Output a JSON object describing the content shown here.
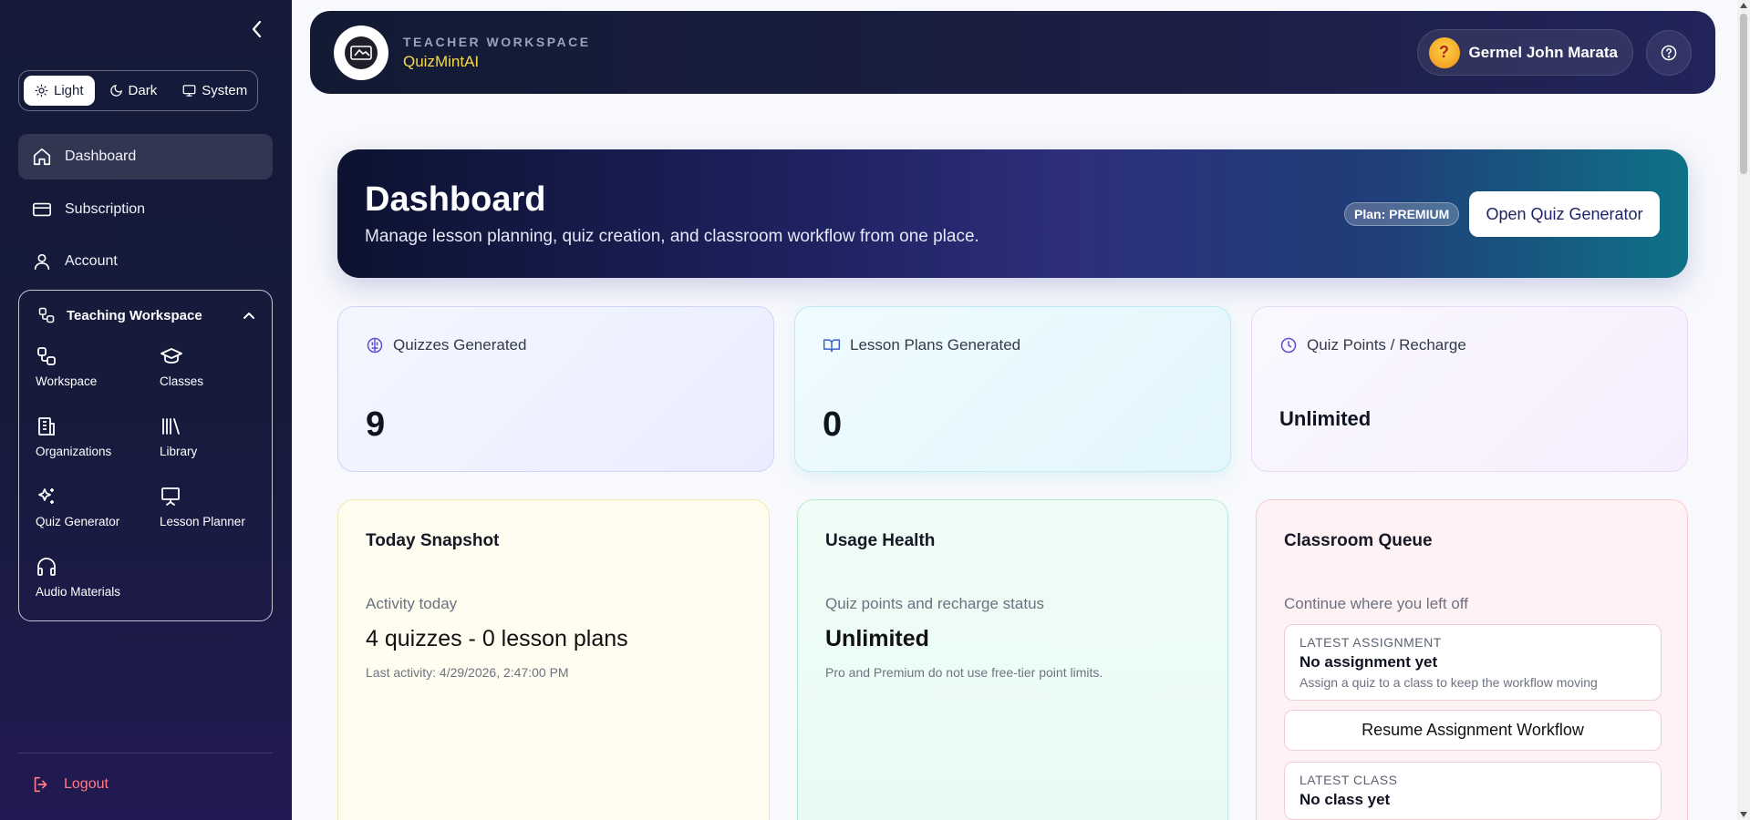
{
  "sidebar": {
    "theme": {
      "options": [
        {
          "label": "Light",
          "icon": "sun-icon",
          "active": true
        },
        {
          "label": "Dark",
          "icon": "moon-icon",
          "active": false
        },
        {
          "label": "System",
          "icon": "monitor-icon",
          "active": false
        }
      ]
    },
    "nav": [
      {
        "label": "Dashboard",
        "icon": "home-icon",
        "active": true
      },
      {
        "label": "Subscription",
        "icon": "credit-card-icon",
        "active": false
      },
      {
        "label": "Account",
        "icon": "user-icon",
        "active": false
      }
    ],
    "workspace_group": {
      "title": "Teaching Workspace",
      "expanded": true,
      "items": [
        {
          "label": "Workspace",
          "icon": "workspace-icon"
        },
        {
          "label": "Classes",
          "icon": "graduation-cap-icon"
        },
        {
          "label": "Organizations",
          "icon": "building-icon"
        },
        {
          "label": "Library",
          "icon": "library-icon"
        },
        {
          "label": "Quiz Generator",
          "icon": "sparkles-icon"
        },
        {
          "label": "Lesson Planner",
          "icon": "presentation-icon"
        },
        {
          "label": "Audio Materials",
          "icon": "headphones-icon"
        }
      ]
    },
    "logout_label": "Logout"
  },
  "topbar": {
    "eyebrow": "TEACHER WORKSPACE",
    "brand": "QuizMintAI",
    "user_name": "Germel John Marata"
  },
  "hero": {
    "title": "Dashboard",
    "subtitle": "Manage lesson planning, quiz creation, and classroom workflow from one place.",
    "plan_badge": "Plan: PREMIUM",
    "cta_label": "Open Quiz Generator"
  },
  "stats": [
    {
      "label": "Quizzes Generated",
      "value": "9",
      "icon": "brain-icon"
    },
    {
      "label": "Lesson Plans Generated",
      "value": "0",
      "icon": "book-open-icon"
    },
    {
      "label": "Quiz Points / Recharge",
      "value": "Unlimited",
      "icon": "clock-icon"
    }
  ],
  "today": {
    "title": "Today Snapshot",
    "label": "Activity today",
    "value": "4 quizzes - 0 lesson plans",
    "note": "Last activity: 4/29/2026, 2:47:00 PM"
  },
  "usage": {
    "title": "Usage Health",
    "label": "Quiz points and recharge status",
    "value": "Unlimited",
    "note": "Pro and Premium do not use free-tier point limits."
  },
  "queue": {
    "title": "Classroom Queue",
    "label": "Continue where you left off",
    "assignment": {
      "eyebrow": "LATEST ASSIGNMENT",
      "title": "No assignment yet",
      "desc": "Assign a quiz to a class to keep the workflow moving"
    },
    "resume_label": "Resume Assignment Workflow",
    "class": {
      "eyebrow": "LATEST CLASS",
      "title": "No class yet"
    }
  },
  "colors": {
    "sidebar_bg": "#161b3c",
    "brand_accent": "#f8d94c",
    "logout": "#ff7a8a",
    "hero_cta_text": "#1e2466"
  }
}
